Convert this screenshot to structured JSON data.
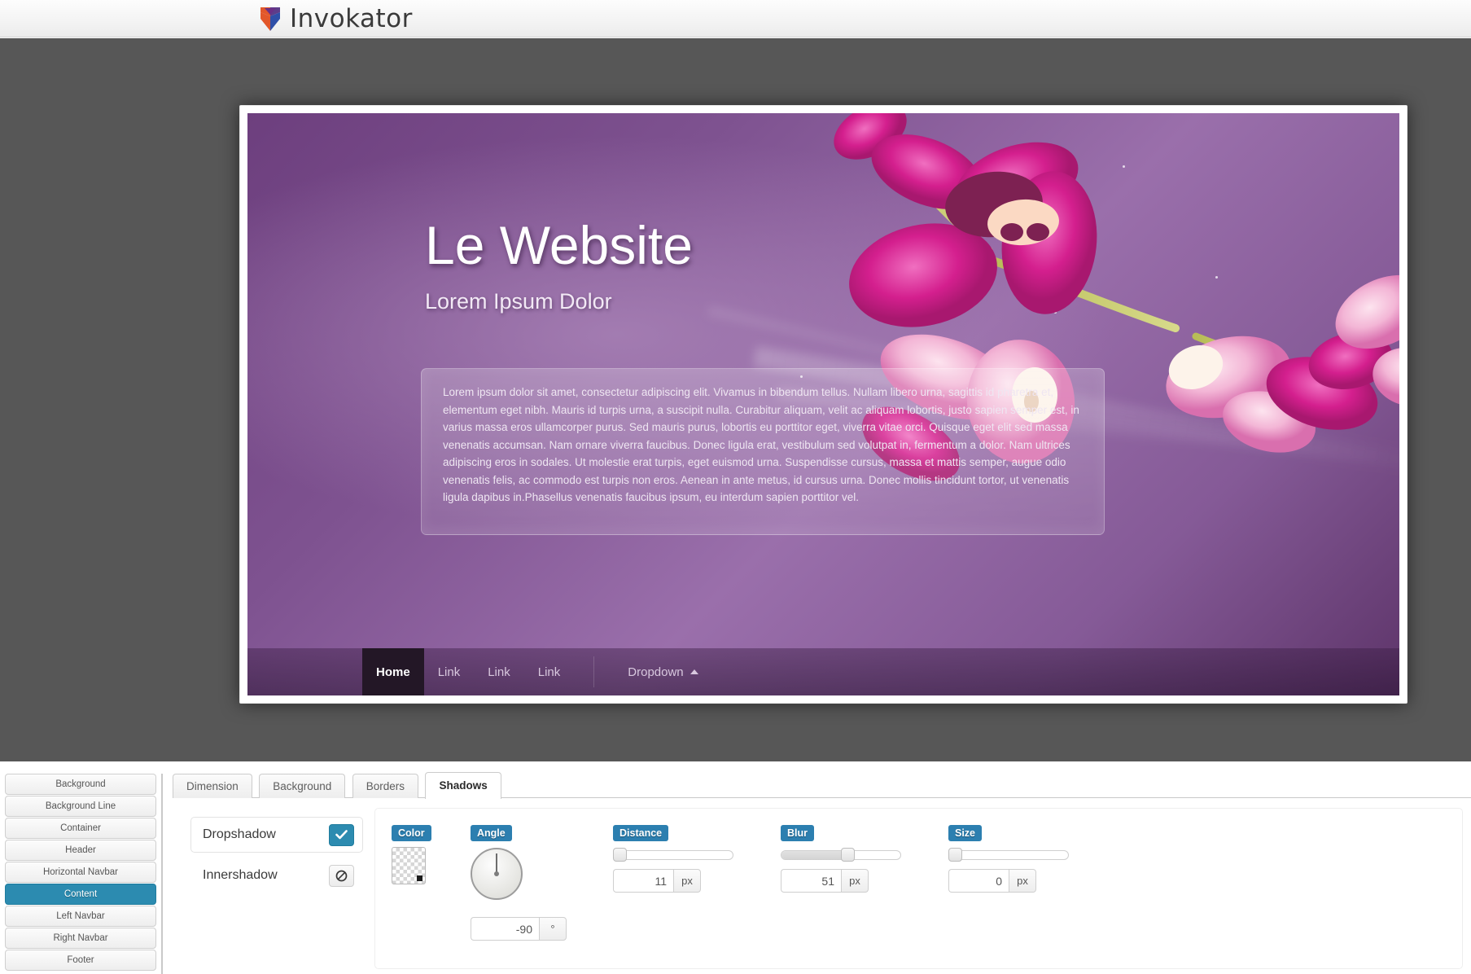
{
  "app": {
    "title": "Invokator",
    "logo_icon": "shield-chevron-logo-icon",
    "logo_colors": {
      "purple": "#5d3d8a",
      "orange": "#e2572a",
      "blue": "#2f4fa8"
    }
  },
  "preview": {
    "hero_title": "Le Website",
    "hero_subtitle": "Lorem Ipsum Dolor",
    "body_text": "Lorem ipsum dolor sit amet, consectetur adipiscing elit. Vivamus in bibendum tellus. Nullam libero urna, sagittis id pharetra et, elementum eget nibh. Mauris id turpis urna, a suscipit nulla. Curabitur aliquam, velit ac aliquam lobortis, justo sapien semper est, in varius massa eros ullamcorper purus. Sed mauris purus, lobortis eu porttitor eget, viverra vitae orci. Quisque eget elit sed massa venenatis accumsan. Nam ornare viverra faucibus. Donec ligula erat, vestibulum sed volutpat in, fermentum a dolor. Nam ultrices adipiscing eros in sodales. Ut molestie erat turpis, eget euismod urna. Suspendisse cursus, massa et mattis semper, augue odio venenatis felis, ac commodo est turpis non eros. Aenean in ante metus, id cursus urna. Donec mollis tincidunt tortor, ut venenatis ligula dapibus in.Phasellus venenatis faucibus ipsum, eu interdum sapien porttitor vel.",
    "nav": {
      "items": [
        {
          "label": "Home",
          "active": true
        },
        {
          "label": "Link",
          "active": false
        },
        {
          "label": "Link",
          "active": false
        },
        {
          "label": "Link",
          "active": false
        }
      ],
      "dropdown_label": "Dropdown",
      "dropdown_caret_icon": "caret-up-icon"
    },
    "image_subject": "pink-orchid-flowers"
  },
  "element_list": {
    "items": [
      {
        "label": "Background",
        "selected": false
      },
      {
        "label": "Background Line",
        "selected": false
      },
      {
        "label": "Container",
        "selected": false
      },
      {
        "label": "Header",
        "selected": false
      },
      {
        "label": "Horizontal Navbar",
        "selected": false
      },
      {
        "label": "Content",
        "selected": true
      },
      {
        "label": "Left Navbar",
        "selected": false
      },
      {
        "label": "Right Navbar",
        "selected": false
      },
      {
        "label": "Footer",
        "selected": false
      }
    ],
    "selected_color": "#2c8bb0"
  },
  "tabs": [
    {
      "label": "Dimension",
      "active": false
    },
    {
      "label": "Background",
      "active": false
    },
    {
      "label": "Borders",
      "active": false
    },
    {
      "label": "Shadows",
      "active": true
    }
  ],
  "shadows": {
    "dropshadow": {
      "label": "Dropshadow",
      "enabled": true,
      "icon": "check-icon"
    },
    "innershadow": {
      "label": "Innershadow",
      "enabled": false,
      "icon": "no-entry-icon"
    },
    "color": {
      "label": "Color",
      "swatch_icon": "transparency-checkerboard-swatch",
      "value": "transparent"
    },
    "angle": {
      "label": "Angle",
      "value": "-90",
      "unit": "°",
      "knob_icon": "rotary-knob-icon"
    },
    "distance": {
      "label": "Distance",
      "value": "11",
      "unit": "px",
      "slider_percent": 4
    },
    "blur": {
      "label": "Blur",
      "value": "51",
      "unit": "px",
      "slider_percent": 55
    },
    "size": {
      "label": "Size",
      "value": "0",
      "unit": "px",
      "slider_percent": 0
    }
  },
  "theme": {
    "accent": "#2c8bb0",
    "label_blue": "#2c7fb0",
    "workspace_bg": "#575757"
  }
}
